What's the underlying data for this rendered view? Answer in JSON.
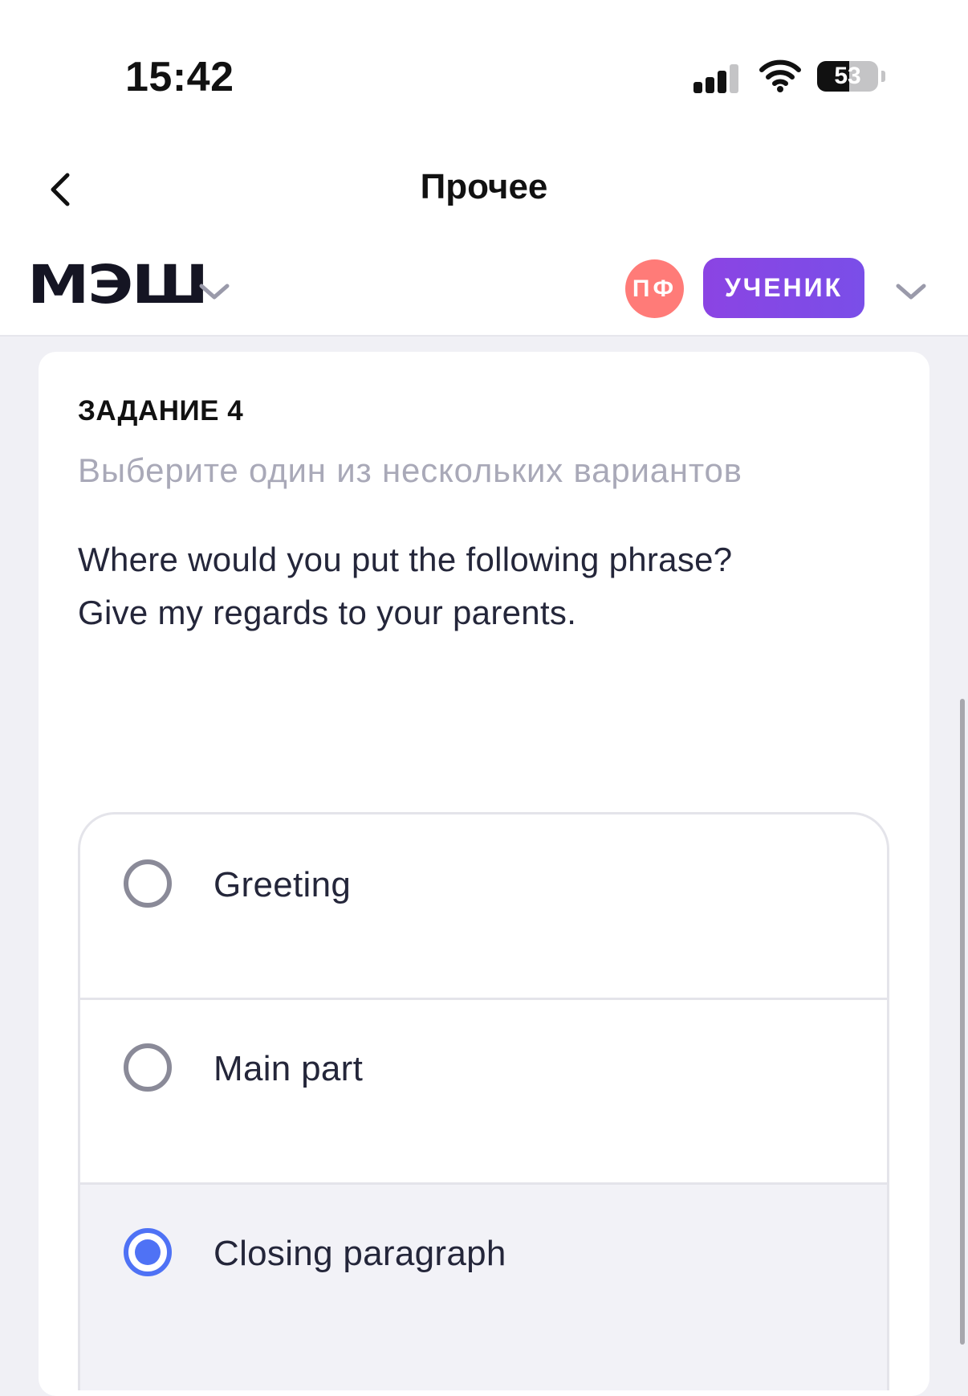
{
  "status_bar": {
    "time": "15:42",
    "battery_level": "53"
  },
  "nav": {
    "title": "Прочее"
  },
  "header": {
    "logo": "МЭШ",
    "avatar_initials": "ПФ",
    "role": "УЧЕНИК"
  },
  "task": {
    "title": "ЗАДАНИЕ 4",
    "instruction": "Выберите один из нескольких вариантов",
    "question_lines": [
      "Where would you put the following phrase?",
      "Give my regards to your parents."
    ],
    "options": [
      {
        "label": "Greeting",
        "selected": false
      },
      {
        "label": "Main part",
        "selected": false
      },
      {
        "label": "Closing paragraph",
        "selected": true
      }
    ]
  },
  "colors": {
    "accent_blue": "#4f72f5",
    "role_purple": "#8b44e3",
    "avatar_red": "#ff7b78",
    "background": "#f0f0f5"
  }
}
